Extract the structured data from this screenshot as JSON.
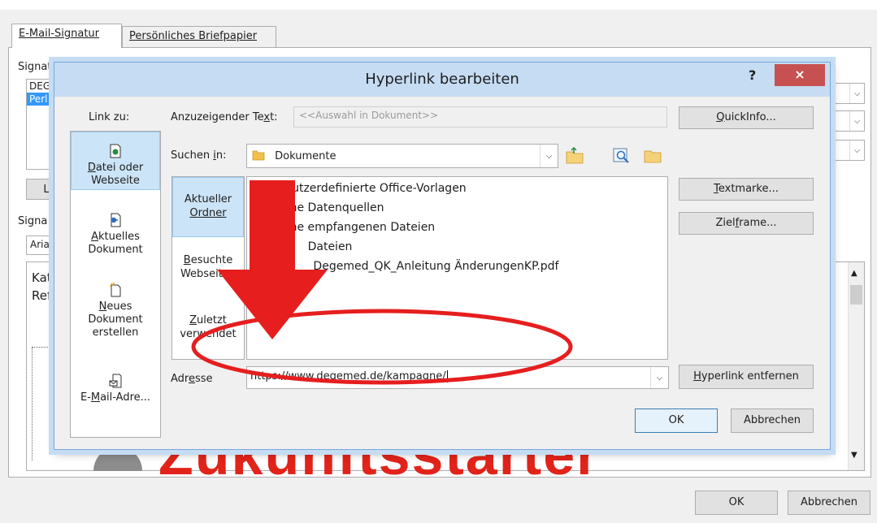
{
  "background_dialog": {
    "tabs": [
      {
        "label": "E-Mail-Signatur",
        "active": true
      },
      {
        "label": "Persönliches Briefpapier",
        "active": false
      }
    ],
    "signature_label_partial": "Signat",
    "signature_list": [
      "DEG",
      "Perl"
    ],
    "button_partial": "L",
    "edit_signature_label_partial": "Signa",
    "font_field_partial": "Aria",
    "editor_text_lines": [
      "Kat",
      "Ref"
    ],
    "logo_text": "Zukunftsstarter",
    "ok_label": "OK",
    "cancel_label": "Abbrechen"
  },
  "dialog": {
    "title": "Hyperlink bearbeiten",
    "help": "?",
    "close": "×",
    "link_to_label": "Link zu:",
    "link_to_items": [
      {
        "label_pre": "",
        "label_ul": "D",
        "label_post": "atei oder Webseite",
        "icon": "file-link-icon",
        "selected": true
      },
      {
        "label_pre": "",
        "label_ul": "A",
        "label_post": "ktuelles Dokument",
        "icon": "current-document-icon",
        "selected": false
      },
      {
        "label_pre": "",
        "label_ul": "N",
        "label_post": "eues Dokument erstellen",
        "icon": "new-document-icon",
        "selected": false
      },
      {
        "label_pre": "E-",
        "label_ul": "M",
        "label_post": "ail-Adre...",
        "icon": "email-icon",
        "selected": false
      }
    ],
    "display_text": {
      "label_pre": "Anzuzeigender Te",
      "label_ul": "x",
      "label_post": "t:",
      "value": "<<Auswahl in Dokument>>"
    },
    "quickinfo": {
      "label_pre": "",
      "label_ul": "Q",
      "label_post": "uickInfo..."
    },
    "look_in": {
      "label_pre": "Suchen ",
      "label_ul": "i",
      "label_post": "n:",
      "value": "Dokumente"
    },
    "sub_nav": [
      {
        "line1": "Aktueller",
        "line2_ul": "O",
        "line2_post": "rdner",
        "selected": true
      },
      {
        "line1_ul": "B",
        "line1_post": "esuchte",
        "line2": "Webseiten",
        "selected": false
      },
      {
        "line1_ul": "Z",
        "line1_post": "uletzt",
        "line2": "verwendet",
        "selected": false
      }
    ],
    "files": [
      {
        "name": "Benutzerdefinierte Office-Vorlagen",
        "icon": "folder-icon"
      },
      {
        "name": "Meine Datenquellen",
        "icon": "data-source-folder-icon"
      },
      {
        "name": "Meine empfangenen Dateien",
        "icon": "folder-icon"
      },
      {
        "name": "Ou      Dateien",
        "icon": "folder-icon"
      },
      {
        "name": "202      Degemed_QK_Anleitung ÄnderungenKP.pdf",
        "icon": "pdf-icon"
      }
    ],
    "bookmark": {
      "label_pre": "",
      "label_ul": "T",
      "label_post": "extmarke..."
    },
    "target_frame": {
      "label_pre": "Ziel",
      "label_ul": "f",
      "label_post": "rame..."
    },
    "address": {
      "label_pre": "Adr",
      "label_ul": "e",
      "label_post": "sse",
      "value": "https://www.degemed.de/kampagne/"
    },
    "remove_link": {
      "label_pre": "",
      "label_ul": "H",
      "label_post": "yperlink entfernen"
    },
    "ok_label": "OK",
    "cancel_label": "Abbrechen"
  },
  "colors": {
    "annotation_red": "#e61e1e",
    "title_bar": "#c5dcf3",
    "close_button": "#c75050",
    "selection": "#cce4f7"
  }
}
